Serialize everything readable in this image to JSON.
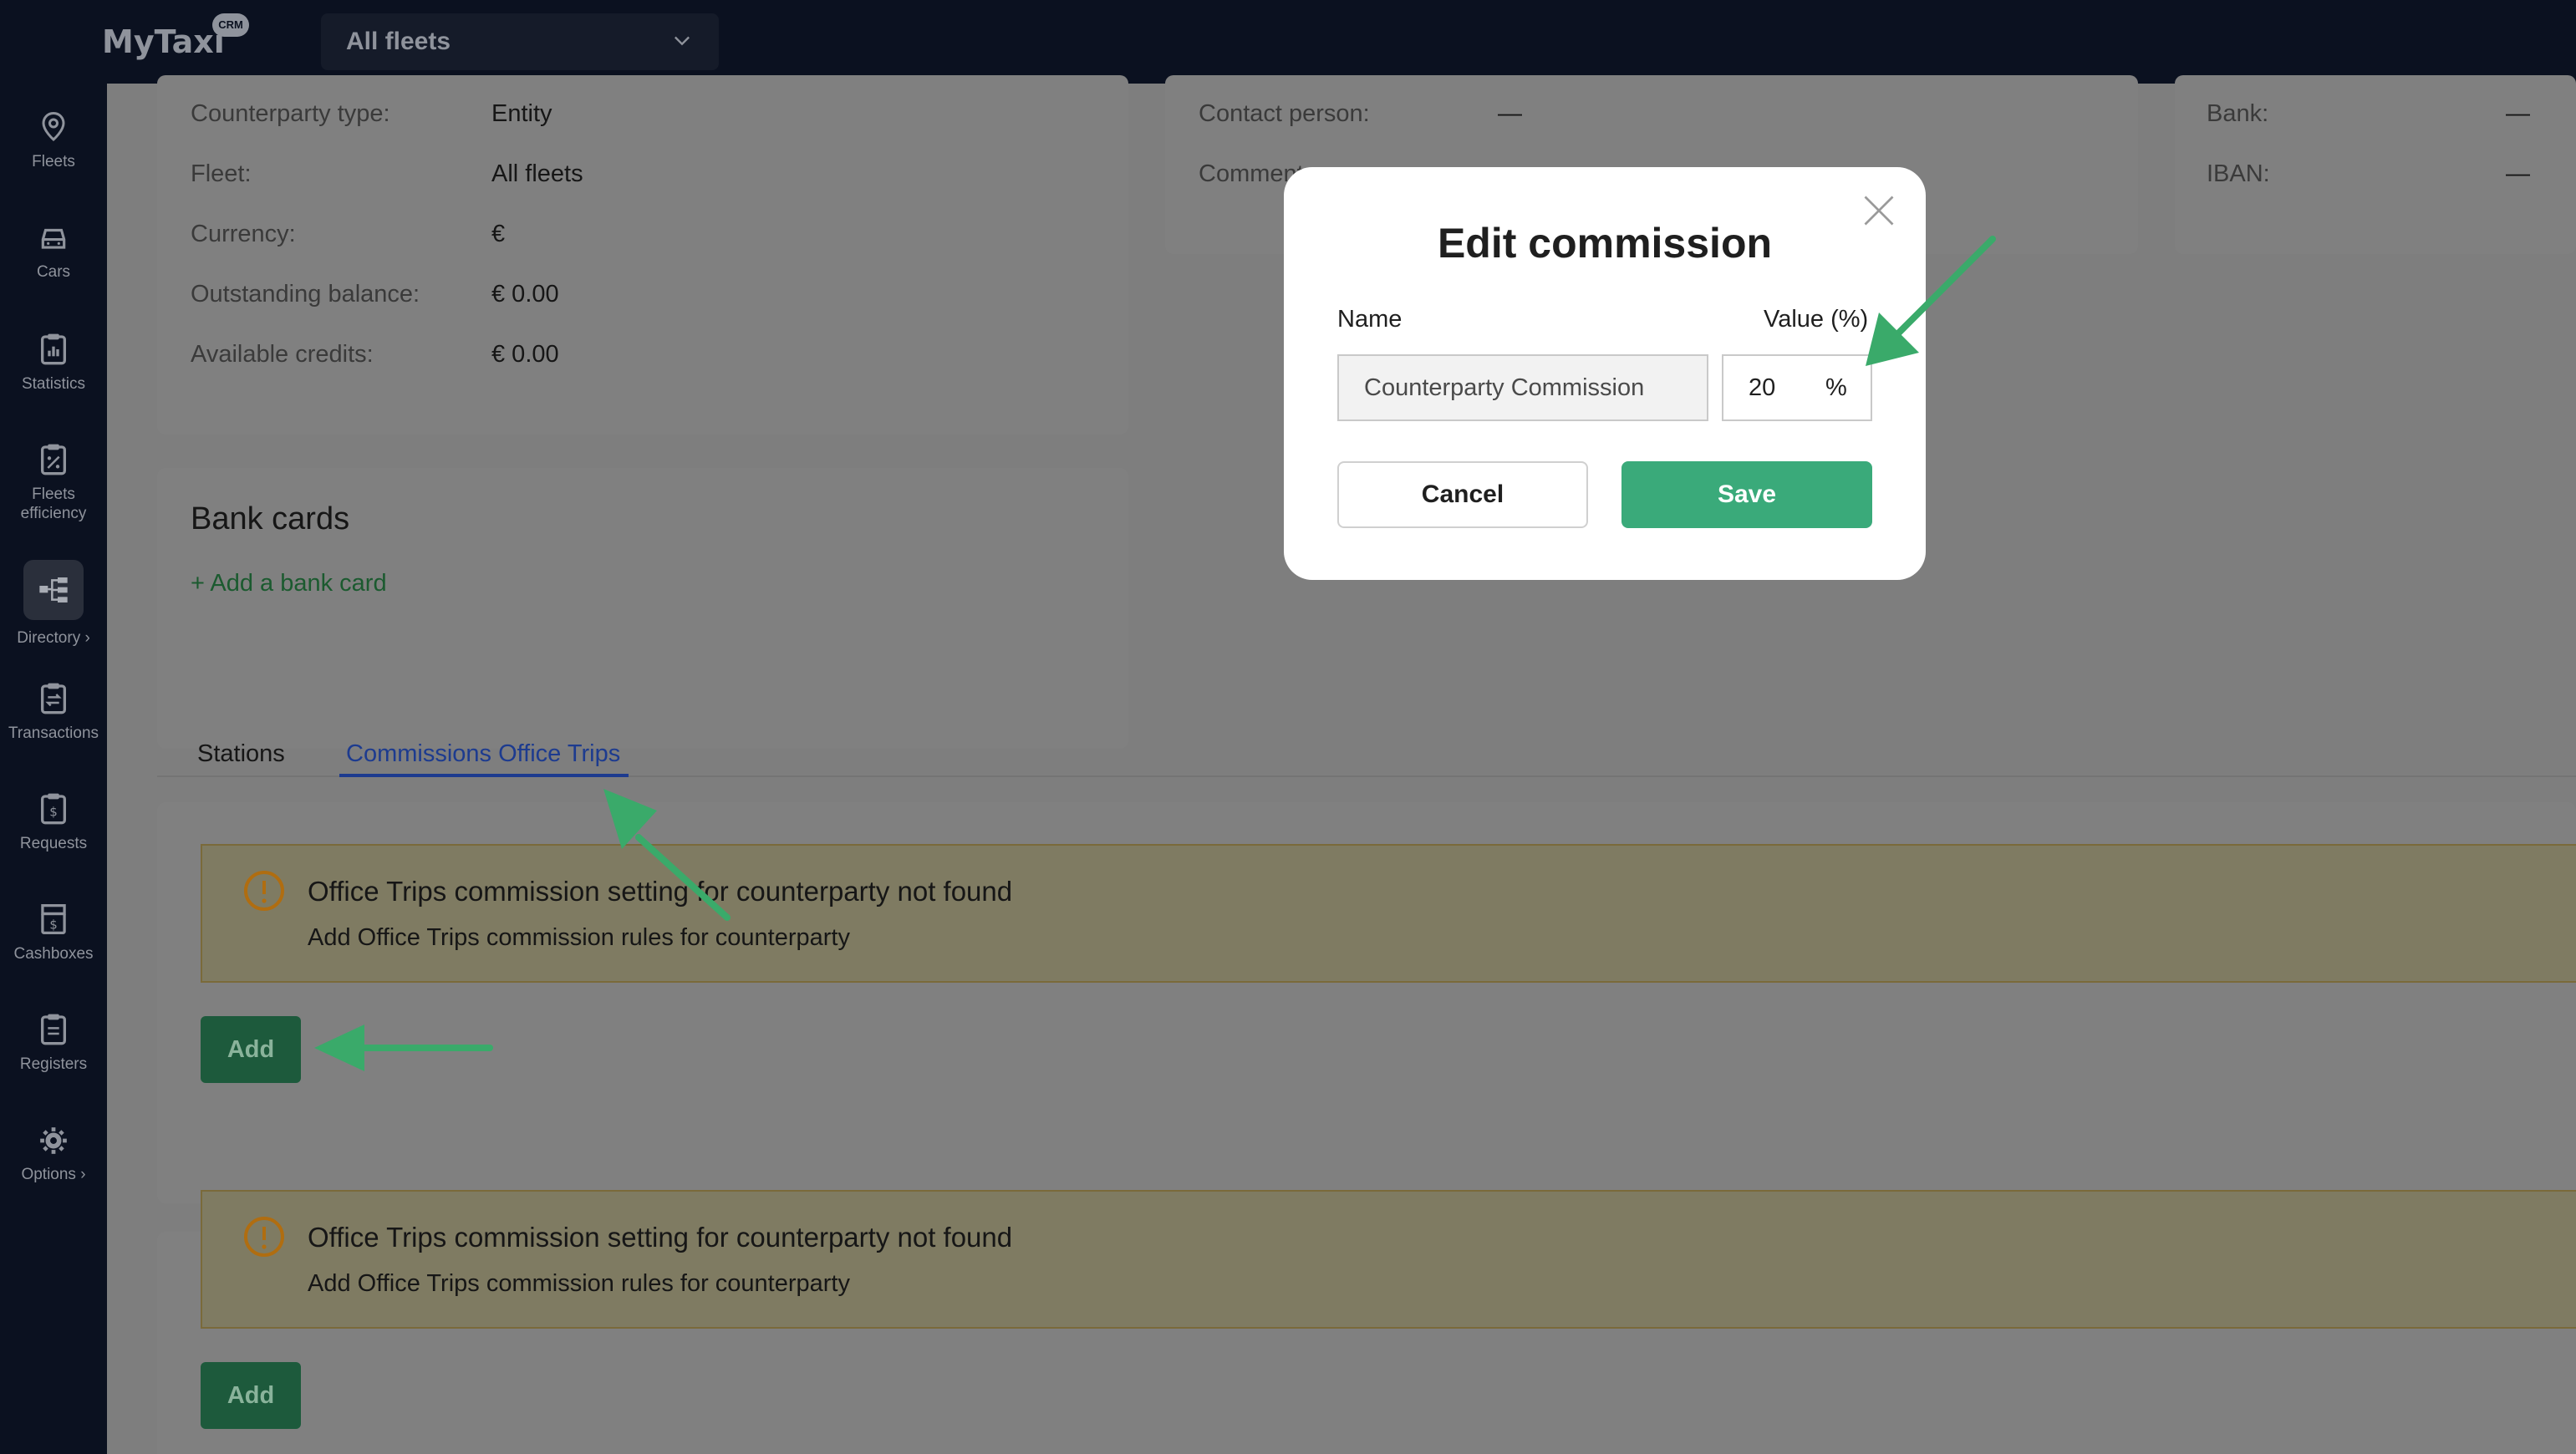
{
  "app": {
    "logo": "MyTaxi",
    "logo_badge": "CRM"
  },
  "header": {
    "fleet_select": "All fleets"
  },
  "sidebar": {
    "items": [
      {
        "label": "Fleets",
        "icon": "location-pin-icon"
      },
      {
        "label": "Cars",
        "icon": "car-icon"
      },
      {
        "label": "Statistics",
        "icon": "clipboard-chart-icon"
      },
      {
        "label": "Fleets efficiency",
        "icon": "clipboard-percent-icon"
      },
      {
        "label": "Directory",
        "icon": "hierarchy-icon",
        "active": true
      },
      {
        "label": "Transactions",
        "icon": "clipboard-transfer-icon"
      },
      {
        "label": "Requests",
        "icon": "clipboard-dollar-icon"
      },
      {
        "label": "Cashboxes",
        "icon": "cashbox-icon"
      },
      {
        "label": "Registers",
        "icon": "clipboard-list-icon"
      },
      {
        "label": "Options",
        "icon": "gear-icon"
      }
    ]
  },
  "details": {
    "counterparty_type": {
      "label": "Counterparty type:",
      "value": "Entity"
    },
    "fleet": {
      "label": "Fleet:",
      "value": "All fleets"
    },
    "currency": {
      "label": "Currency:",
      "value": "€"
    },
    "outstanding_balance": {
      "label": "Outstanding balance:",
      "value": "€ 0.00"
    },
    "available_credits": {
      "label": "Available credits:",
      "value": "€ 0.00"
    },
    "contact_person": {
      "label": "Contact person:",
      "value": "—"
    },
    "comment": {
      "label": "Comment"
    },
    "bank": {
      "label": "Bank:",
      "value": "—"
    },
    "iban": {
      "label": "IBAN:",
      "value": "—"
    }
  },
  "bank_cards": {
    "title": "Bank cards",
    "add_link": "+ Add a bank card"
  },
  "tabs": [
    {
      "label": "Stations",
      "active": false
    },
    {
      "label": "Commissions Office Trips",
      "active": true
    }
  ],
  "alerts": [
    {
      "title": "Office Trips commission setting for counterparty not found",
      "subtitle": "Add Office Trips commission rules for counterparty",
      "button": "Add"
    },
    {
      "title": "Office Trips commission setting for counterparty not found",
      "subtitle": "Add Office Trips commission rules for counterparty",
      "button": "Add"
    }
  ],
  "modal": {
    "title": "Edit commission",
    "name_label": "Name",
    "value_label": "Value (%)",
    "name_value": "Counterparty Commission",
    "value_value": "20",
    "value_unit": "%",
    "cancel": "Cancel",
    "save": "Save"
  },
  "colors": {
    "accent": "#3aaa7a",
    "sidebar": "#0b1120",
    "tab_active": "#1d3b8f",
    "annotation_arrow": "#3aaa6a"
  }
}
